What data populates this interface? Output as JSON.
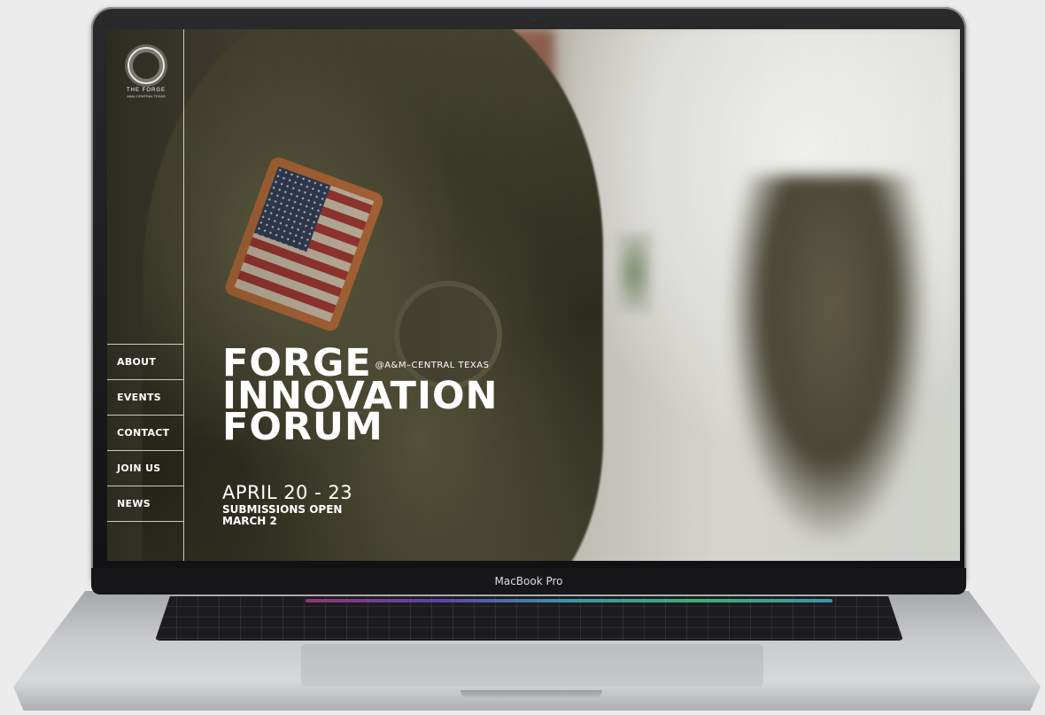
{
  "site": {
    "logo": {
      "name": "THE FORGE",
      "sub": "A&M–CENTRAL TEXAS"
    },
    "nav": [
      {
        "label": "ABOUT"
      },
      {
        "label": "EVENTS"
      },
      {
        "label": "CONTACT"
      },
      {
        "label": "JOIN US"
      },
      {
        "label": "NEWS"
      }
    ],
    "hero": {
      "line1": "FORGE",
      "line1_sub": "@A&M–CENTRAL TEXAS",
      "line2": "INNOVATION",
      "line3": "FORUM"
    },
    "dates": {
      "range": "APRIL 20 - 23",
      "note_line1": "SUBMISSIONS OPEN",
      "note_line2": "MARCH 2"
    }
  },
  "device": {
    "label": "MacBook Pro"
  },
  "colors": {
    "text": "#ffffff",
    "rule": "#ffffff",
    "bezel": "#17171a"
  }
}
